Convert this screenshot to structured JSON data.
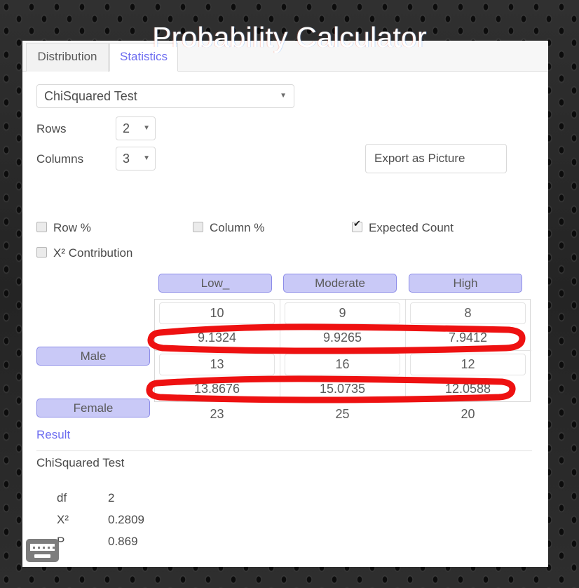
{
  "app": {
    "title": "Probability Calculator"
  },
  "tabs": [
    {
      "label": "Distribution",
      "active": false
    },
    {
      "label": "Statistics",
      "active": true
    }
  ],
  "controls": {
    "test_select": {
      "value": "ChiSquared Test",
      "caret": "chevron-down-icon"
    },
    "rows": {
      "label": "Rows",
      "value": "2"
    },
    "columns": {
      "label": "Columns",
      "value": "3"
    },
    "export_button": {
      "label": "Export as Picture"
    }
  },
  "options": [
    {
      "label": "Row %",
      "checked": false
    },
    {
      "label": "Column %",
      "checked": false
    },
    {
      "label": "Expected Count",
      "checked": true
    },
    {
      "label": "X² Contribution",
      "checked": false
    }
  ],
  "table": {
    "column_headers": [
      "Low_",
      "Moderate",
      "High"
    ],
    "row_headers": [
      "Male",
      "Female"
    ],
    "observed": [
      [
        "10",
        "9",
        "8"
      ],
      [
        "13",
        "16",
        "12"
      ]
    ],
    "expected": [
      [
        "9.1324",
        "9.9265",
        "7.9412"
      ],
      [
        "13.8676",
        "15.0735",
        "12.0588"
      ]
    ],
    "column_totals": [
      "23",
      "25",
      "20"
    ]
  },
  "annotations": {
    "color": "#ee1111",
    "shapes": [
      {
        "name": "highlight-expected-row-male",
        "target": "expected row 1"
      },
      {
        "name": "highlight-expected-row-female",
        "target": "expected row 2"
      }
    ]
  },
  "result": {
    "heading": "Result",
    "test_name": "ChiSquared Test",
    "stats": [
      {
        "key": "df",
        "value": "2"
      },
      {
        "key": "X²",
        "value": "0.2809"
      },
      {
        "key": "P",
        "value": "0.869"
      }
    ]
  },
  "statusbar": {
    "keyboard_icon": "keyboard-icon"
  }
}
